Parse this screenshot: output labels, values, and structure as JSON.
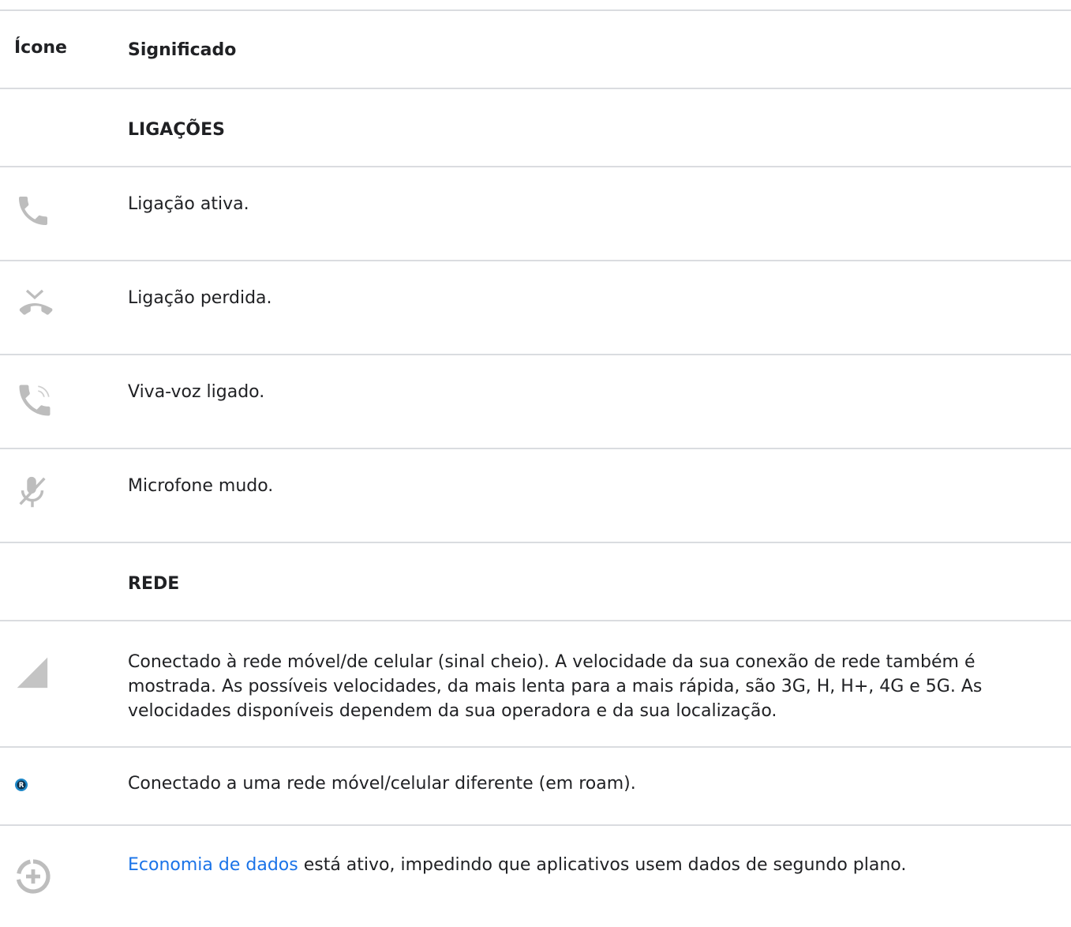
{
  "header": {
    "icon_col": "Ícone",
    "meaning_col": "Significado"
  },
  "sections": {
    "calls": "LIGAÇÕES",
    "network": "REDE"
  },
  "rows": {
    "active_call": "Ligação ativa.",
    "missed_call": "Ligação perdida.",
    "speaker_on": "Viva-voz ligado.",
    "mic_muted": "Microfone mudo.",
    "mobile_signal": "Conectado à rede móvel/de celular (sinal cheio). A velocidade da sua conexão de rede também é mostrada. As possíveis velocidades, da mais lenta para a mais rápida, são 3G, H, H+, 4G e 5G. As velocidades disponíveis dependem da sua operadora e da sua localização.",
    "roaming": "Conectado a uma rede móvel/celular diferente (em roam).",
    "data_saver_link": "Economia de dados",
    "data_saver_rest": " está ativo, impedindo que aplicativos usem dados de segundo plano."
  },
  "icons": {
    "active_call": "phone-icon",
    "missed_call": "missed-call-icon",
    "speaker_on": "speakerphone-icon",
    "mic_muted": "mic-off-icon",
    "mobile_signal": "signal-full-icon",
    "roaming": "roaming-icon",
    "data_saver": "data-saver-icon"
  },
  "colors": {
    "icon_gray": "#bdbdbd",
    "link": "#1a73e8",
    "roam_blue": "#1e88c8",
    "divider": "#dadce0"
  }
}
